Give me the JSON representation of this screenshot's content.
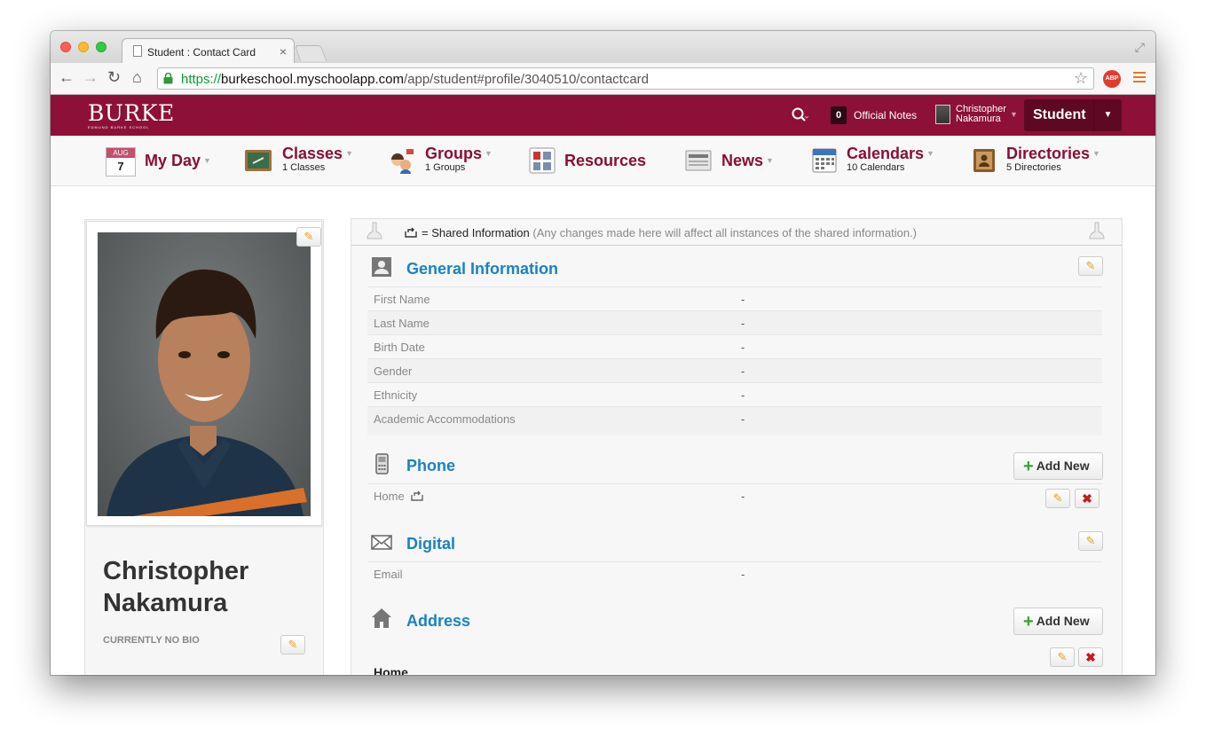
{
  "browser": {
    "tab_title": "Student : Contact Card",
    "tab_close": "×",
    "url_scheme": "https://",
    "url_host": "burkeschool.myschoolapp.com",
    "url_path": "/app/student#profile/3040510/contactcard",
    "abp_label": "ABP"
  },
  "header": {
    "logo": "BURKE",
    "logo_sub": "EDMUND BURKE SCHOOL",
    "notes_count": "0",
    "notes_label": "Official Notes",
    "user_first": "Christopher",
    "user_last": "Nakamura",
    "role": "Student"
  },
  "nav": {
    "myday": {
      "label": "My Day",
      "month": "AUG",
      "day": "7"
    },
    "classes": {
      "label": "Classes",
      "sub": "1 Classes"
    },
    "groups": {
      "label": "Groups",
      "sub": "1 Groups"
    },
    "resources": {
      "label": "Resources"
    },
    "news": {
      "label": "News"
    },
    "calendars": {
      "label": "Calendars",
      "sub": "10 Calendars"
    },
    "directories": {
      "label": "Directories",
      "sub": "5 Directories"
    }
  },
  "profile": {
    "name": "Christopher Nakamura",
    "bio": "CURRENTLY NO BIO"
  },
  "shared": {
    "label": "= Shared Information",
    "note": "(Any changes made here will affect all instances of the shared information.)"
  },
  "general": {
    "title": "General Information",
    "rows": [
      {
        "k": "First Name",
        "v": "-"
      },
      {
        "k": "Last Name",
        "v": "-"
      },
      {
        "k": "Birth Date",
        "v": "-"
      },
      {
        "k": "Gender",
        "v": "-"
      },
      {
        "k": "Ethnicity",
        "v": "-"
      },
      {
        "k": "Academic Accommodations",
        "v": "-"
      }
    ]
  },
  "phone": {
    "title": "Phone",
    "add": "Add New",
    "row_k": "Home",
    "row_v": "-"
  },
  "digital": {
    "title": "Digital",
    "row_k": "Email",
    "row_v": "-"
  },
  "address": {
    "title": "Address",
    "add": "Add New",
    "home": "Home"
  },
  "colors": {
    "brand": "#8c1038",
    "link": "#1a82c4"
  }
}
